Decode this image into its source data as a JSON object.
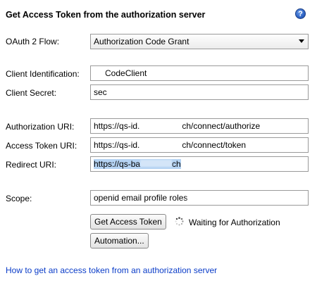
{
  "header": {
    "title": "Get Access Token from the authorization server",
    "help_glyph": "?"
  },
  "flow": {
    "label": "OAuth 2 Flow:",
    "value": "Authorization Code Grant"
  },
  "client_id": {
    "label": "Client Identification:",
    "value": "CodeClient"
  },
  "client_secret": {
    "label": "Client Secret:",
    "value": "sec"
  },
  "auth_uri": {
    "label": "Authorization URI:",
    "value_start": "https://qs-id.",
    "value_end": "ch/connect/authorize"
  },
  "token_uri": {
    "label": "Access Token URI:",
    "value_start": "https://qs-id.",
    "value_end": "ch/connect/token"
  },
  "redirect_uri": {
    "label": "Redirect URI:",
    "value_start": "https://qs-ba",
    "value_end": "ch"
  },
  "scope": {
    "label": "Scope:",
    "value": "openid email profile roles"
  },
  "actions": {
    "get_token_label": "Get Access Token",
    "status": "Waiting for Authorization",
    "automation_label": "Automation..."
  },
  "footer": {
    "link": "How to get an access token from an authorization server"
  },
  "colors": {
    "link": "#0a3cc8",
    "selection": "#b5d3f3",
    "help_icon": "#2e63c4"
  },
  "icons": {
    "help": "help-icon",
    "dropdown": "chevron-down-icon",
    "spinner": "spinner-icon"
  }
}
